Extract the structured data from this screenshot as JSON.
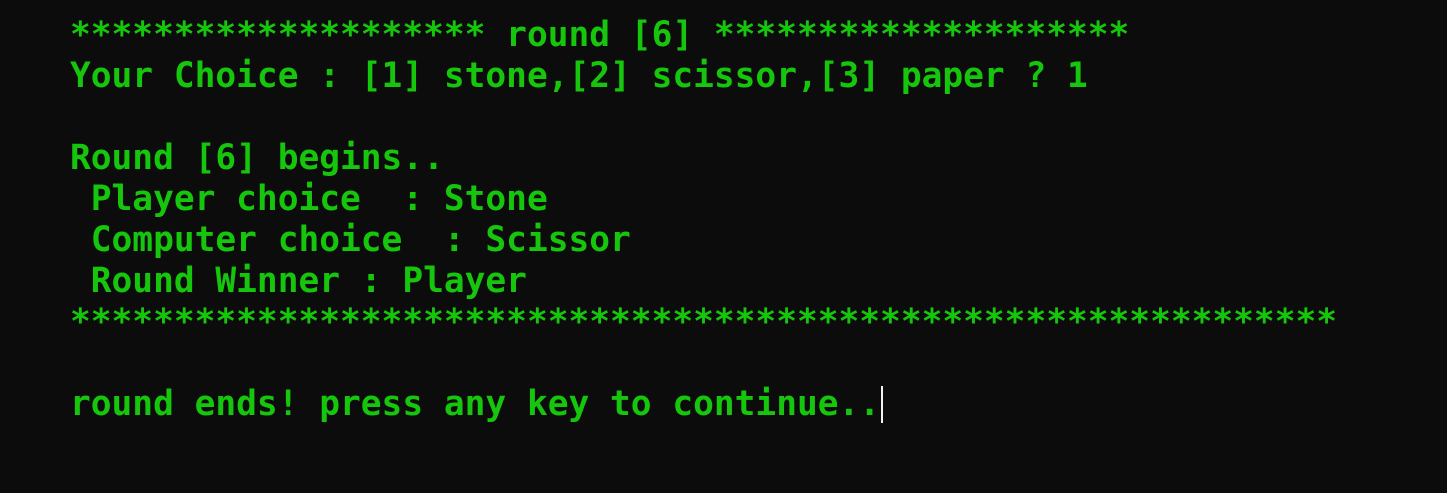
{
  "terminal": {
    "text_color": "#16c60c",
    "background_color": "#0c0c0c",
    "cursor_color": "#f2f2f2",
    "lines": [
      "******************** round [6] ********************",
      "Your Choice : [1] stone,[2] scissor,[3] paper ? 1",
      "",
      "Round [6] begins..",
      " Player choice  : Stone",
      " Computer choice  : Scissor",
      " Round Winner : Player",
      "*************************************************************",
      "",
      "round ends! press any key to continue.."
    ]
  }
}
